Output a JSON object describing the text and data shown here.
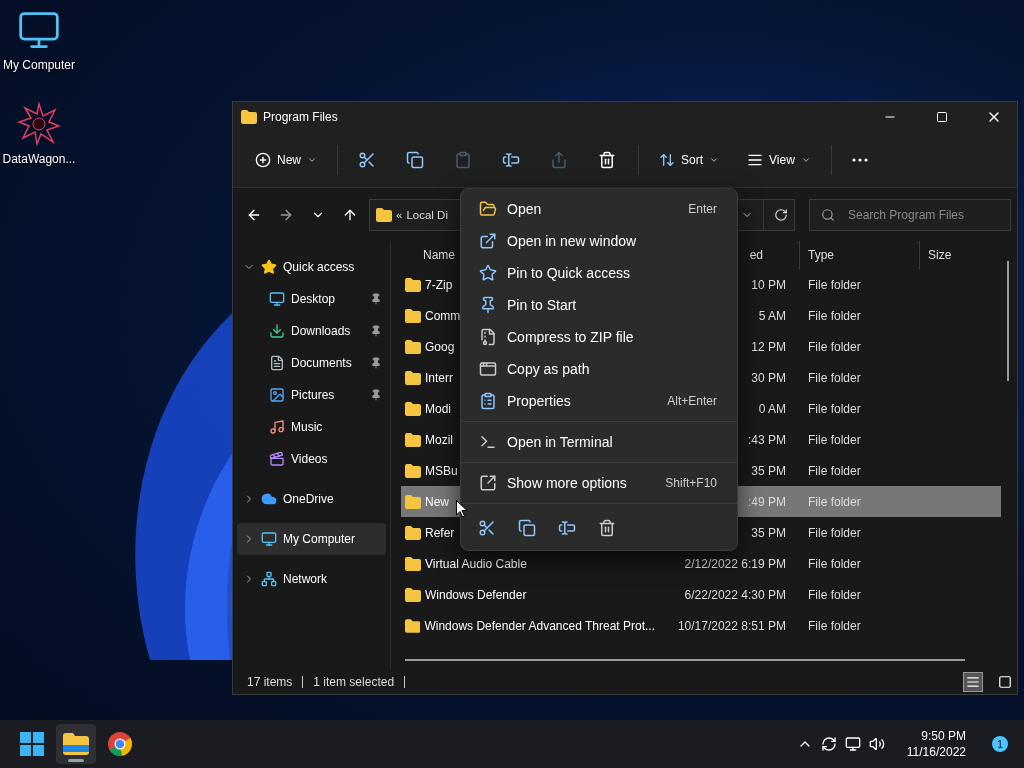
{
  "desktop": {
    "icons": [
      {
        "kind": "computer",
        "label": "My Computer"
      },
      {
        "kind": "shortcut",
        "label": "DataWagon..."
      }
    ]
  },
  "window": {
    "title": "Program Files"
  },
  "toolbar": {
    "new_label": "New",
    "sort_label": "Sort",
    "view_label": "View",
    "actions": [
      {
        "kind": "cut",
        "disabled": false
      },
      {
        "kind": "copy",
        "disabled": false
      },
      {
        "kind": "paste",
        "disabled": true
      },
      {
        "kind": "rename",
        "disabled": false
      },
      {
        "kind": "share",
        "disabled": true
      },
      {
        "kind": "delete",
        "disabled": false
      }
    ]
  },
  "address_bar": {
    "overflow": "«",
    "path": "Local Di"
  },
  "search": {
    "placeholder": "Search Program Files"
  },
  "sidebar": {
    "items": [
      {
        "kind": "star",
        "label": "Quick access",
        "expanded": true,
        "selected": false,
        "children": [
          {
            "kind": "desktop",
            "label": "Desktop",
            "pinned": true,
            "selected": false
          },
          {
            "kind": "downloads",
            "label": "Downloads",
            "pinned": true,
            "selected": false
          },
          {
            "kind": "documents",
            "label": "Documents",
            "pinned": true,
            "selected": false
          },
          {
            "kind": "pictures",
            "label": "Pictures",
            "pinned": true,
            "selected": false
          },
          {
            "kind": "music",
            "label": "Music",
            "pinned": false,
            "selected": false
          },
          {
            "kind": "videos",
            "label": "Videos",
            "pinned": false,
            "selected": false
          }
        ]
      },
      {
        "kind": "cloud",
        "label": "OneDrive",
        "expanded": false,
        "selected": false
      },
      {
        "kind": "computer",
        "label": "My Computer",
        "expanded": false,
        "selected": true
      },
      {
        "kind": "network",
        "label": "Network",
        "expanded": false,
        "selected": false
      }
    ]
  },
  "table": {
    "columns": [
      "Name",
      "ed",
      "Type",
      "Size"
    ],
    "rows": [
      {
        "name": "7-Zip",
        "date": "10 PM",
        "type": "File folder",
        "selected": false
      },
      {
        "name": "Comm",
        "date": "5 AM",
        "type": "File folder",
        "selected": false
      },
      {
        "name": "Goog",
        "date": "12 PM",
        "type": "File folder",
        "selected": false
      },
      {
        "name": "Interr",
        "date": "30 PM",
        "type": "File folder",
        "selected": false
      },
      {
        "name": "Modi",
        "date": "0 AM",
        "type": "File folder",
        "selected": false
      },
      {
        "name": "Mozil",
        "date": ":43 PM",
        "type": "File folder",
        "selected": false
      },
      {
        "name": "MSBu",
        "date": "35 PM",
        "type": "File folder",
        "selected": false
      },
      {
        "name": "New",
        "date": ":49 PM",
        "type": "File folder",
        "selected": true
      },
      {
        "name": "Refer",
        "date": "35 PM",
        "type": "File folder",
        "selected": false
      },
      {
        "name": "Virtual Audio Cable",
        "date": "2/12/2022 6:19 PM",
        "type": "File folder",
        "selected": false
      },
      {
        "name": "Windows Defender",
        "date": "6/22/2022 4:30 PM",
        "type": "File folder",
        "selected": false
      },
      {
        "name": "Windows Defender Advanced Threat Prot...",
        "date": "10/17/2022 8:51 PM",
        "type": "File folder",
        "selected": false
      }
    ]
  },
  "context_menu": {
    "sections": [
      {
        "items": [
          {
            "kind": "open",
            "label": "Open",
            "shortcut": "Enter"
          },
          {
            "kind": "window",
            "label": "Open in new window"
          },
          {
            "kind": "star",
            "label": "Pin to Quick access"
          },
          {
            "kind": "pin",
            "label": "Pin to Start"
          },
          {
            "kind": "zip",
            "label": "Compress to ZIP file"
          },
          {
            "kind": "path",
            "label": "Copy as path"
          },
          {
            "kind": "properties",
            "label": "Properties",
            "shortcut": "Alt+Enter"
          }
        ]
      },
      {
        "items": [
          {
            "kind": "terminal",
            "label": "Open in Terminal"
          }
        ]
      },
      {
        "items": [
          {
            "kind": "more",
            "label": "Show more options",
            "shortcut": "Shift+F10"
          }
        ]
      }
    ],
    "actions": [
      {
        "kind": "cut"
      },
      {
        "kind": "copy"
      },
      {
        "kind": "rename"
      },
      {
        "kind": "delete"
      }
    ]
  },
  "status_bar": {
    "item_count": "17 items",
    "selection": "1 item selected"
  },
  "view_toggle": [
    {
      "kind": "details",
      "selected": true
    },
    {
      "kind": "tiles",
      "selected": false
    }
  ],
  "taskbar": {
    "apps": [
      {
        "kind": "start",
        "selected": false
      },
      {
        "kind": "explorer",
        "selected": true
      },
      {
        "kind": "browser",
        "selected": false
      }
    ],
    "time": "9:50 PM",
    "date": "11/16/2022",
    "notifications": "1"
  }
}
